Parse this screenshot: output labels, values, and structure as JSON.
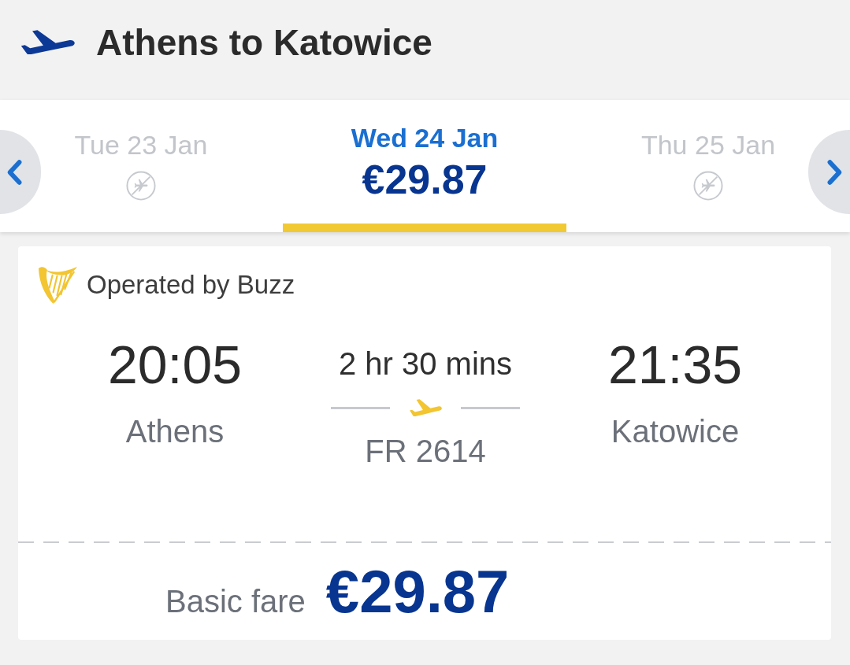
{
  "header": {
    "title": "Athens to Katowice"
  },
  "date_tabs": [
    {
      "label": "Tue 23 Jan",
      "selected": false,
      "kind": "no_flights"
    },
    {
      "label": "Wed 24 Jan",
      "selected": true,
      "kind": "fare",
      "price": "€29.87"
    },
    {
      "label": "Thu 25 Jan",
      "selected": false,
      "kind": "no_flights"
    }
  ],
  "flight": {
    "operator": "Operated by Buzz",
    "departure": {
      "time": "20:05",
      "city": "Athens"
    },
    "duration": "2 hr 30 mins",
    "flight_number": "FR 2614",
    "arrival": {
      "time": "21:35",
      "city": "Katowice"
    }
  },
  "fare": {
    "label": "Basic fare",
    "price": "€29.87"
  }
}
